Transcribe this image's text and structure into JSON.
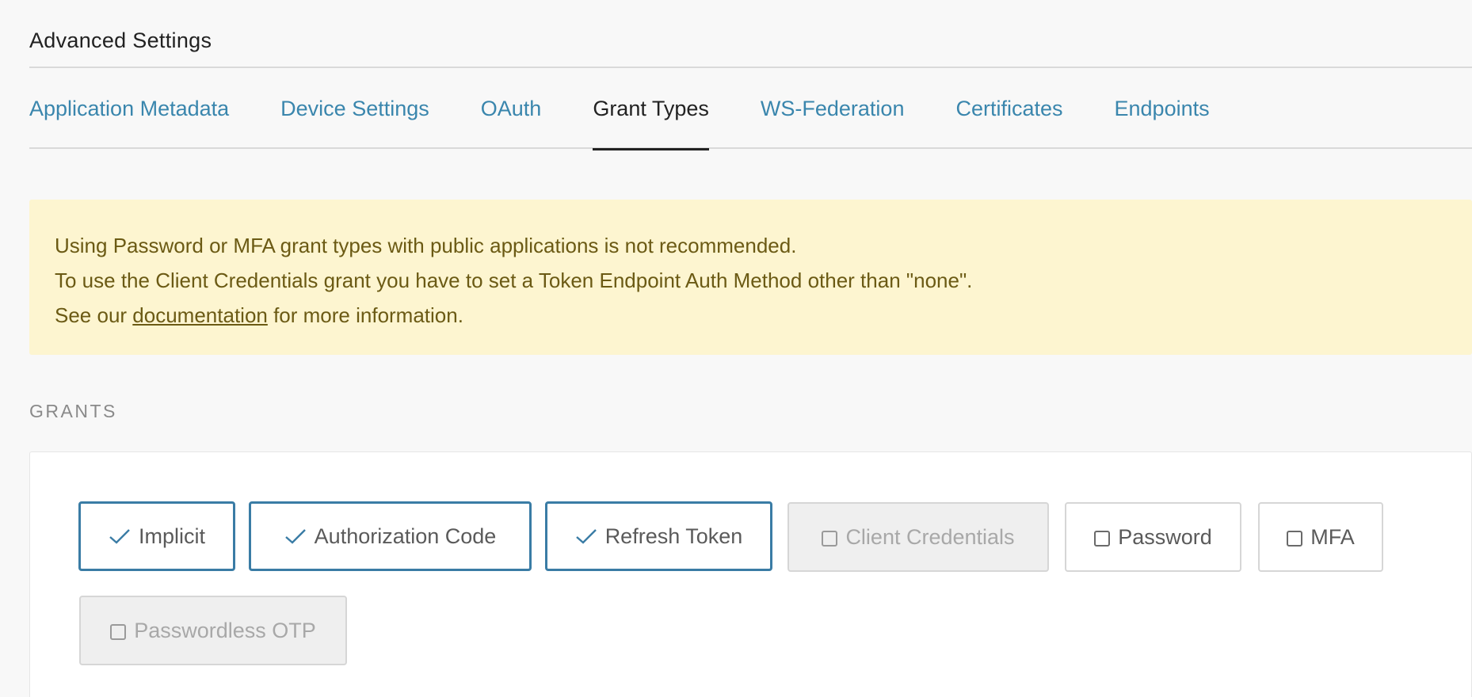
{
  "header": {
    "title": "Advanced Settings"
  },
  "tabs": [
    {
      "label": "Application Metadata",
      "active": false
    },
    {
      "label": "Device Settings",
      "active": false
    },
    {
      "label": "OAuth",
      "active": false
    },
    {
      "label": "Grant Types",
      "active": true
    },
    {
      "label": "WS-Federation",
      "active": false
    },
    {
      "label": "Certificates",
      "active": false
    },
    {
      "label": "Endpoints",
      "active": false
    }
  ],
  "alert": {
    "line1": "Using Password or MFA grant types with public applications is not recommended.",
    "line2": "To use the Client Credentials grant you have to set a Token Endpoint Auth Method other than \"none\".",
    "line3_before": "See our ",
    "line3_link": "documentation",
    "line3_after": " for more information."
  },
  "grants": {
    "section_label": "GRANTS",
    "items": [
      {
        "label": "Implicit",
        "state": "checked"
      },
      {
        "label": "Authorization Code",
        "state": "checked"
      },
      {
        "label": "Refresh Token",
        "state": "checked"
      },
      {
        "label": "Client Credentials",
        "state": "disabled"
      },
      {
        "label": "Password",
        "state": "unchecked"
      },
      {
        "label": "MFA",
        "state": "unchecked"
      },
      {
        "label": "Passwordless OTP",
        "state": "disabled"
      }
    ]
  },
  "colors": {
    "link": "#3a86ad",
    "checked_border": "#3a7ca5",
    "alert_bg": "#fdf5d0",
    "alert_text": "#6b5a14"
  }
}
